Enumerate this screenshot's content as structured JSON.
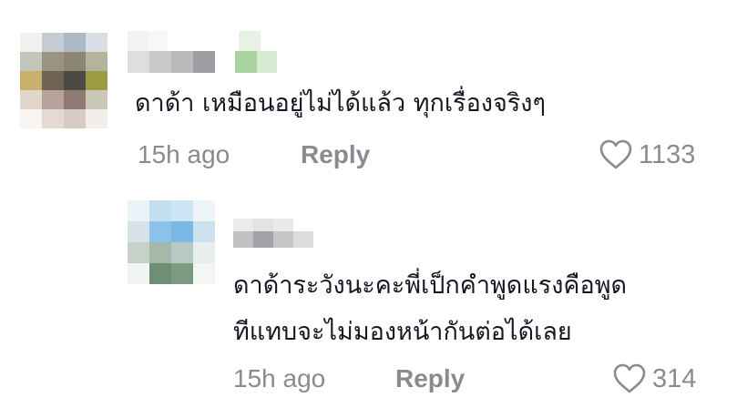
{
  "comments": [
    {
      "text": "ดาด้า เหมือนอยู่ไม่ได้แล้ว ทุกเรื่องจริงๆ",
      "time": "15h ago",
      "reply_label": "Reply",
      "likes": "1133"
    },
    {
      "text_line1": "ดาด้าระวังนะคะพี่เป็กคำพูดแรงคือพูด",
      "text_line2": "ทีแทบจะไม่มองหน้ากันต่อได้เลย",
      "time": "15h ago",
      "reply_label": "Reply",
      "likes": "314"
    }
  ],
  "icons": {
    "like": "heart-outline-icon"
  },
  "colors": {
    "meta_gray": "#8a8b91",
    "text": "#161823"
  }
}
